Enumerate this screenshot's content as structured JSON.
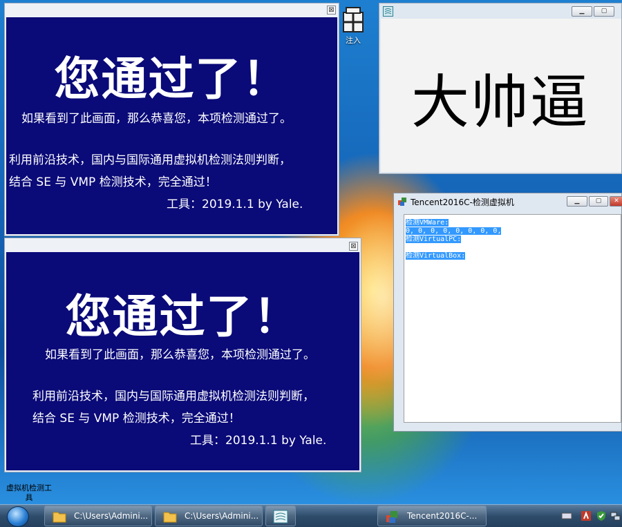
{
  "pass_window": {
    "close_glyph": "⊠",
    "headline": "您通过了！",
    "line1": "如果看到了此画面，那么恭喜您，本项检测通过了。",
    "line2": "利用前沿技术，国内与国际通用虚拟机检测法则判断，",
    "line3": "结合 SE 与 VMP 检测技术，完全通过！",
    "line4": "工具：2019.1.1  by Yale."
  },
  "desktop": {
    "inject_label": "注入",
    "tool_label": "虚拟机检测工\n具"
  },
  "white_window": {
    "caption": "大帅逼"
  },
  "tencent_window": {
    "title": "Tencent2016C-检测虚拟机",
    "output_lines": [
      "检测VMWare:",
      "0, 0, 0, 0, 0, 0, 0, 0,",
      "检测VirtualPC:",
      "",
      "检测VirtualBox:"
    ]
  },
  "taskbar": {
    "items": [
      {
        "label": "C:\\Users\\Admini..."
      },
      {
        "label": "C:\\Users\\Admini..."
      },
      {
        "label": ""
      },
      {
        "label": "Tencent2016C-..."
      }
    ]
  }
}
